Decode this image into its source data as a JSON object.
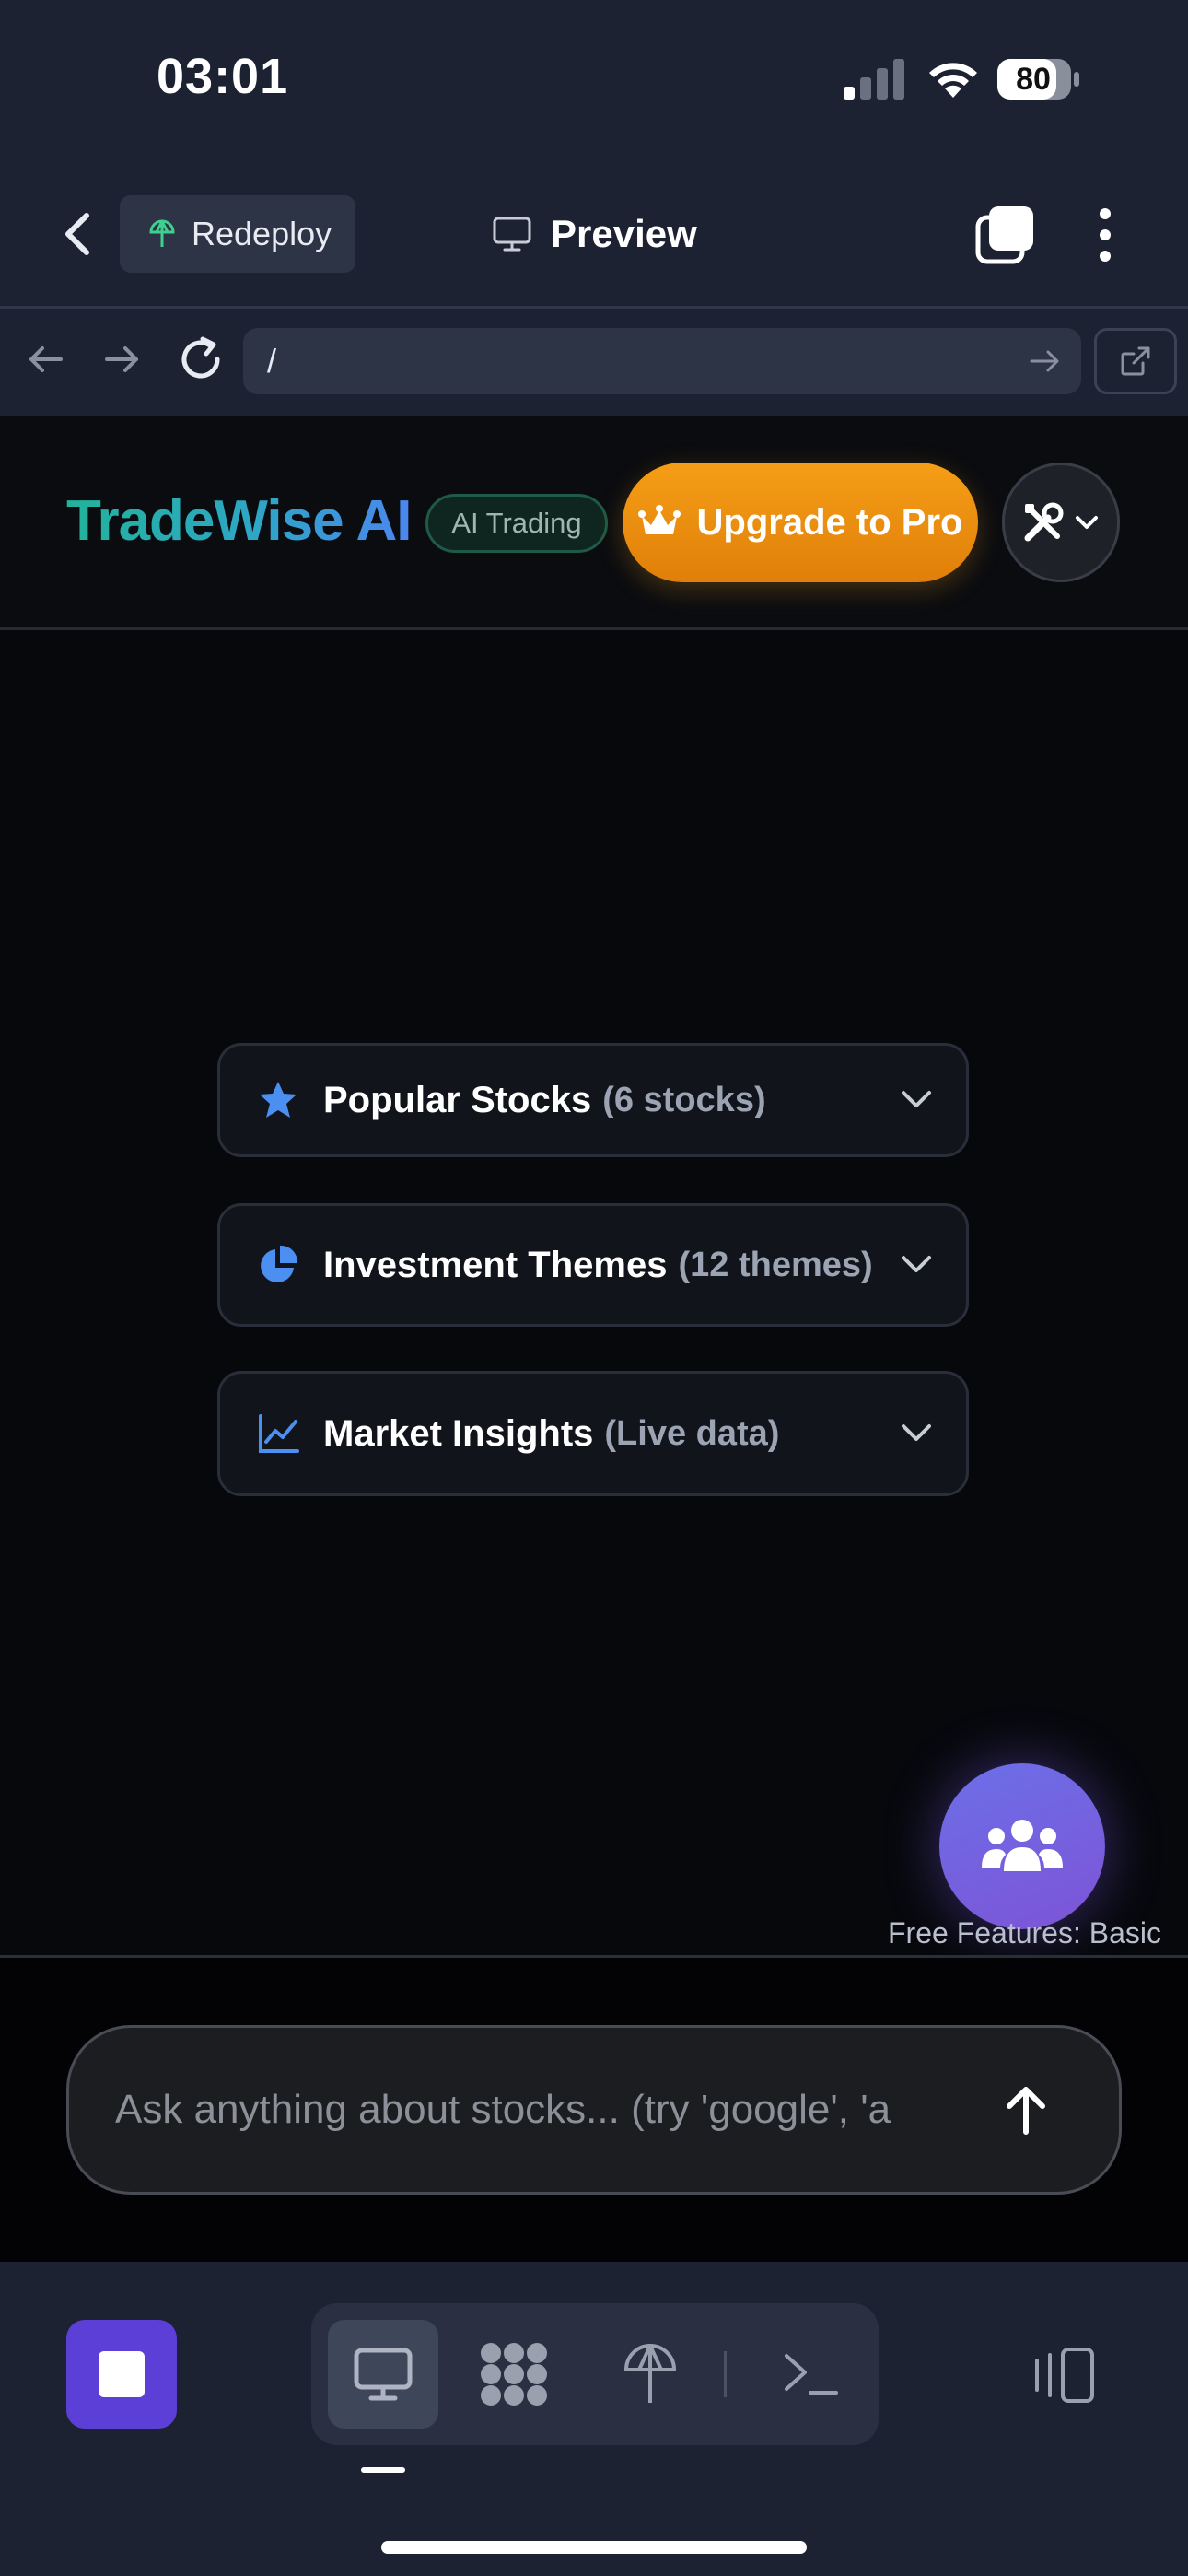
{
  "status_bar": {
    "time": "03:01",
    "battery": "80"
  },
  "top_bar": {
    "redeploy_label": "Redeploy",
    "preview_label": "Preview"
  },
  "url_bar": {
    "value": "/"
  },
  "app": {
    "brand": "TradeWise AI",
    "badge": "AI Trading",
    "upgrade_label": "Upgrade to Pro",
    "sections": [
      {
        "title": "Popular Stocks",
        "meta": "(6 stocks)",
        "icon": "star-icon"
      },
      {
        "title": "Investment Themes",
        "meta": "(12 themes)",
        "icon": "pie-chart-icon"
      },
      {
        "title": "Market Insights",
        "meta": "(Live data)",
        "icon": "line-chart-icon"
      }
    ],
    "free_features": "Free Features: Basic",
    "chat_placeholder": "Ask anything about stocks... (try 'google', 'a"
  },
  "colors": {
    "brand_start": "#22b39a",
    "brand_end": "#4b86f0",
    "upgrade": "#f59e16",
    "accent_blue": "#4b8ff0",
    "stop_button": "#5b3fd6"
  }
}
